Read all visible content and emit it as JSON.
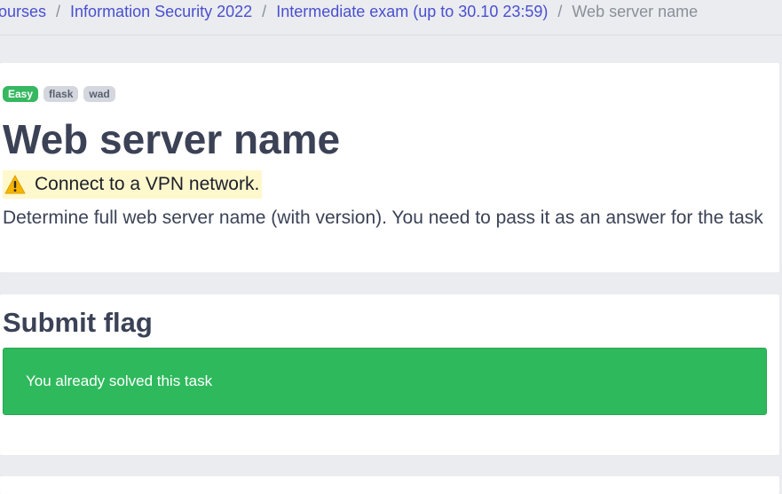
{
  "breadcrumb": {
    "items": [
      {
        "label": "ourses"
      },
      {
        "label": "Information Security 2022"
      },
      {
        "label": "Intermediate exam (up to 30.10 23:59)"
      }
    ],
    "separator": "/",
    "current": "Web server name"
  },
  "task": {
    "tags": [
      "Easy",
      "flask",
      "wad"
    ],
    "title": "Web server name",
    "warning_icon": "warning-icon",
    "warning": "Connect to a VPN network.",
    "description": "Determine full web server name (with version). You need to pass it as an answer for the task"
  },
  "submit": {
    "title": "Submit flag",
    "message": "You already solved this task"
  },
  "colors": {
    "link": "#4a4fd0",
    "success": "#2fb95d",
    "tag_easy": "#35b85f",
    "warning_bg": "#fff8cc",
    "text": "#3b4256"
  }
}
